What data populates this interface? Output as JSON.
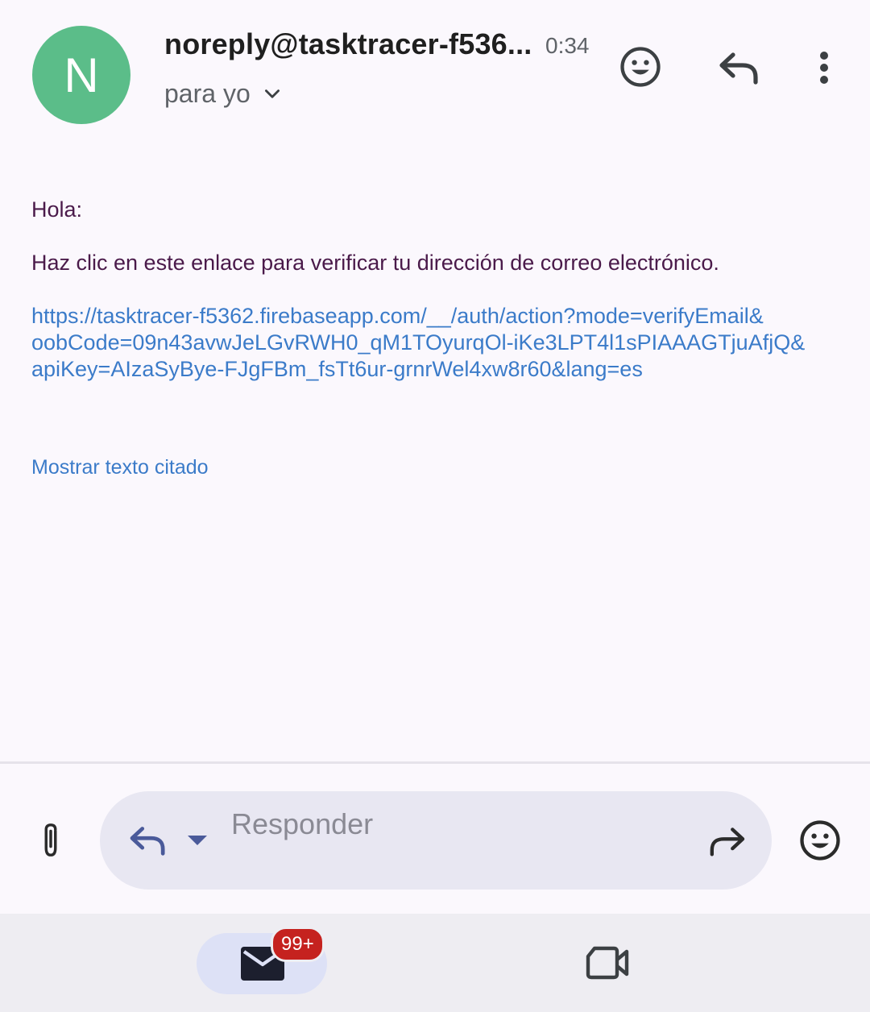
{
  "header": {
    "avatar_letter": "N",
    "sender": "noreply@tasktracer-f536...",
    "time": "0:34",
    "recipient": "para yo",
    "icons": [
      "emoji-reaction-icon",
      "reply-icon",
      "more-vert-icon",
      "chevron-down-icon"
    ]
  },
  "message": {
    "greeting": "Hola:",
    "instruction": "Haz clic en este enlace para verificar tu dirección de correo electrónico.",
    "link_lines": [
      "https://tasktracer-f5362.firebaseapp.com/__/auth/action?mode=verifyEmail&",
      "oobCode=09n43avwJeLGvRWH0_qM1TOyurqOl-iKe3LPT4l1sPIAAAGTjuAfjQ&",
      "apiKey=AIzaSyBye-FJgFBm_fsTt6ur-grnrWel4xw8r60&lang=es"
    ],
    "show_quoted": "Mostrar texto citado"
  },
  "reply_bar": {
    "placeholder": "Responder",
    "icons": [
      "attachment-icon",
      "reply-icon",
      "dropdown-icon",
      "forward-icon",
      "emoji-icon"
    ]
  },
  "bottom_nav": {
    "mail_badge": "99+",
    "icons": [
      "mail-icon",
      "video-camera-icon"
    ]
  },
  "colors": {
    "avatar": "#5bbd89",
    "link": "#3b7bc9",
    "body_text": "#4a1a4a",
    "badge": "#c5221f"
  }
}
